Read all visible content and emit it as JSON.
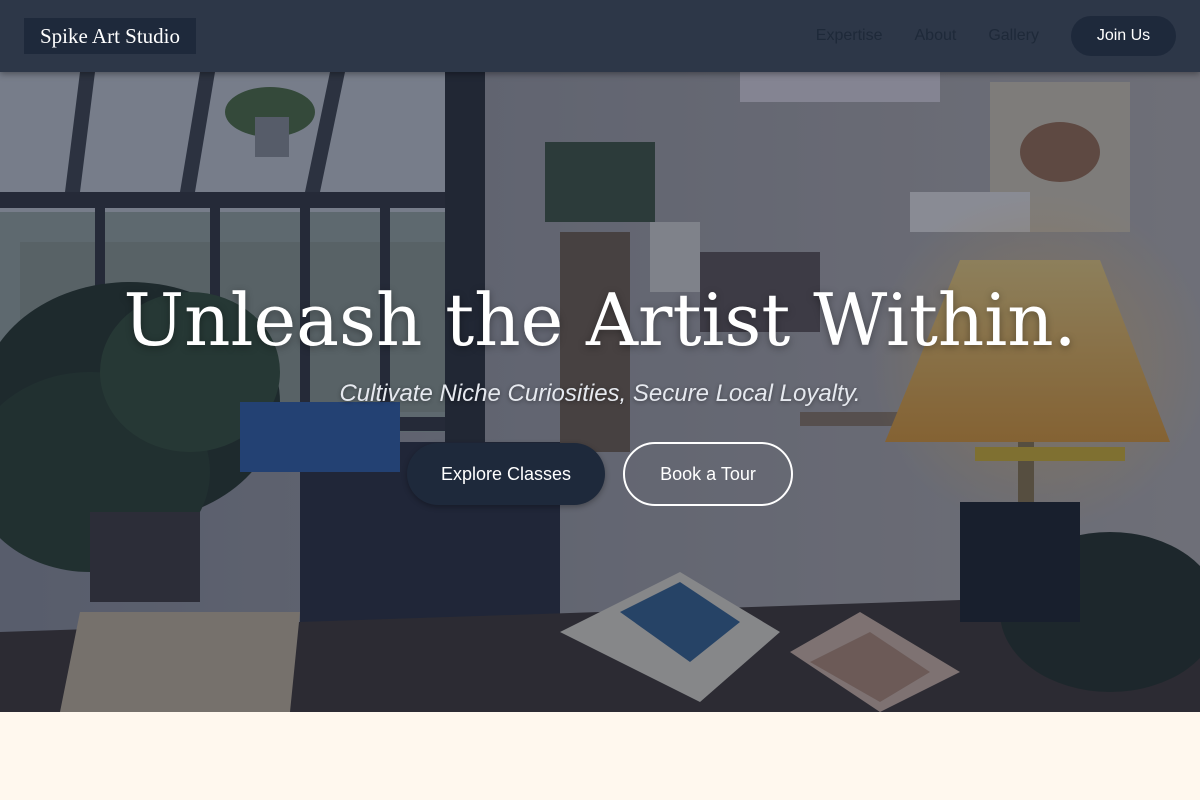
{
  "nav": {
    "logo": "Spike Art Studio",
    "links": [
      "Expertise",
      "About",
      "Gallery"
    ],
    "cta": "Join Us"
  },
  "hero": {
    "title": "Unleash the Artist Within.",
    "subtitle": "Cultivate Niche Curiosities, Secure Local Loyalty.",
    "primary_button": "Explore Classes",
    "secondary_button": "Book a Tour"
  },
  "colors": {
    "navbar": "#2d3748",
    "accent_dark": "#1e293b",
    "page_background": "#fff8ee"
  }
}
